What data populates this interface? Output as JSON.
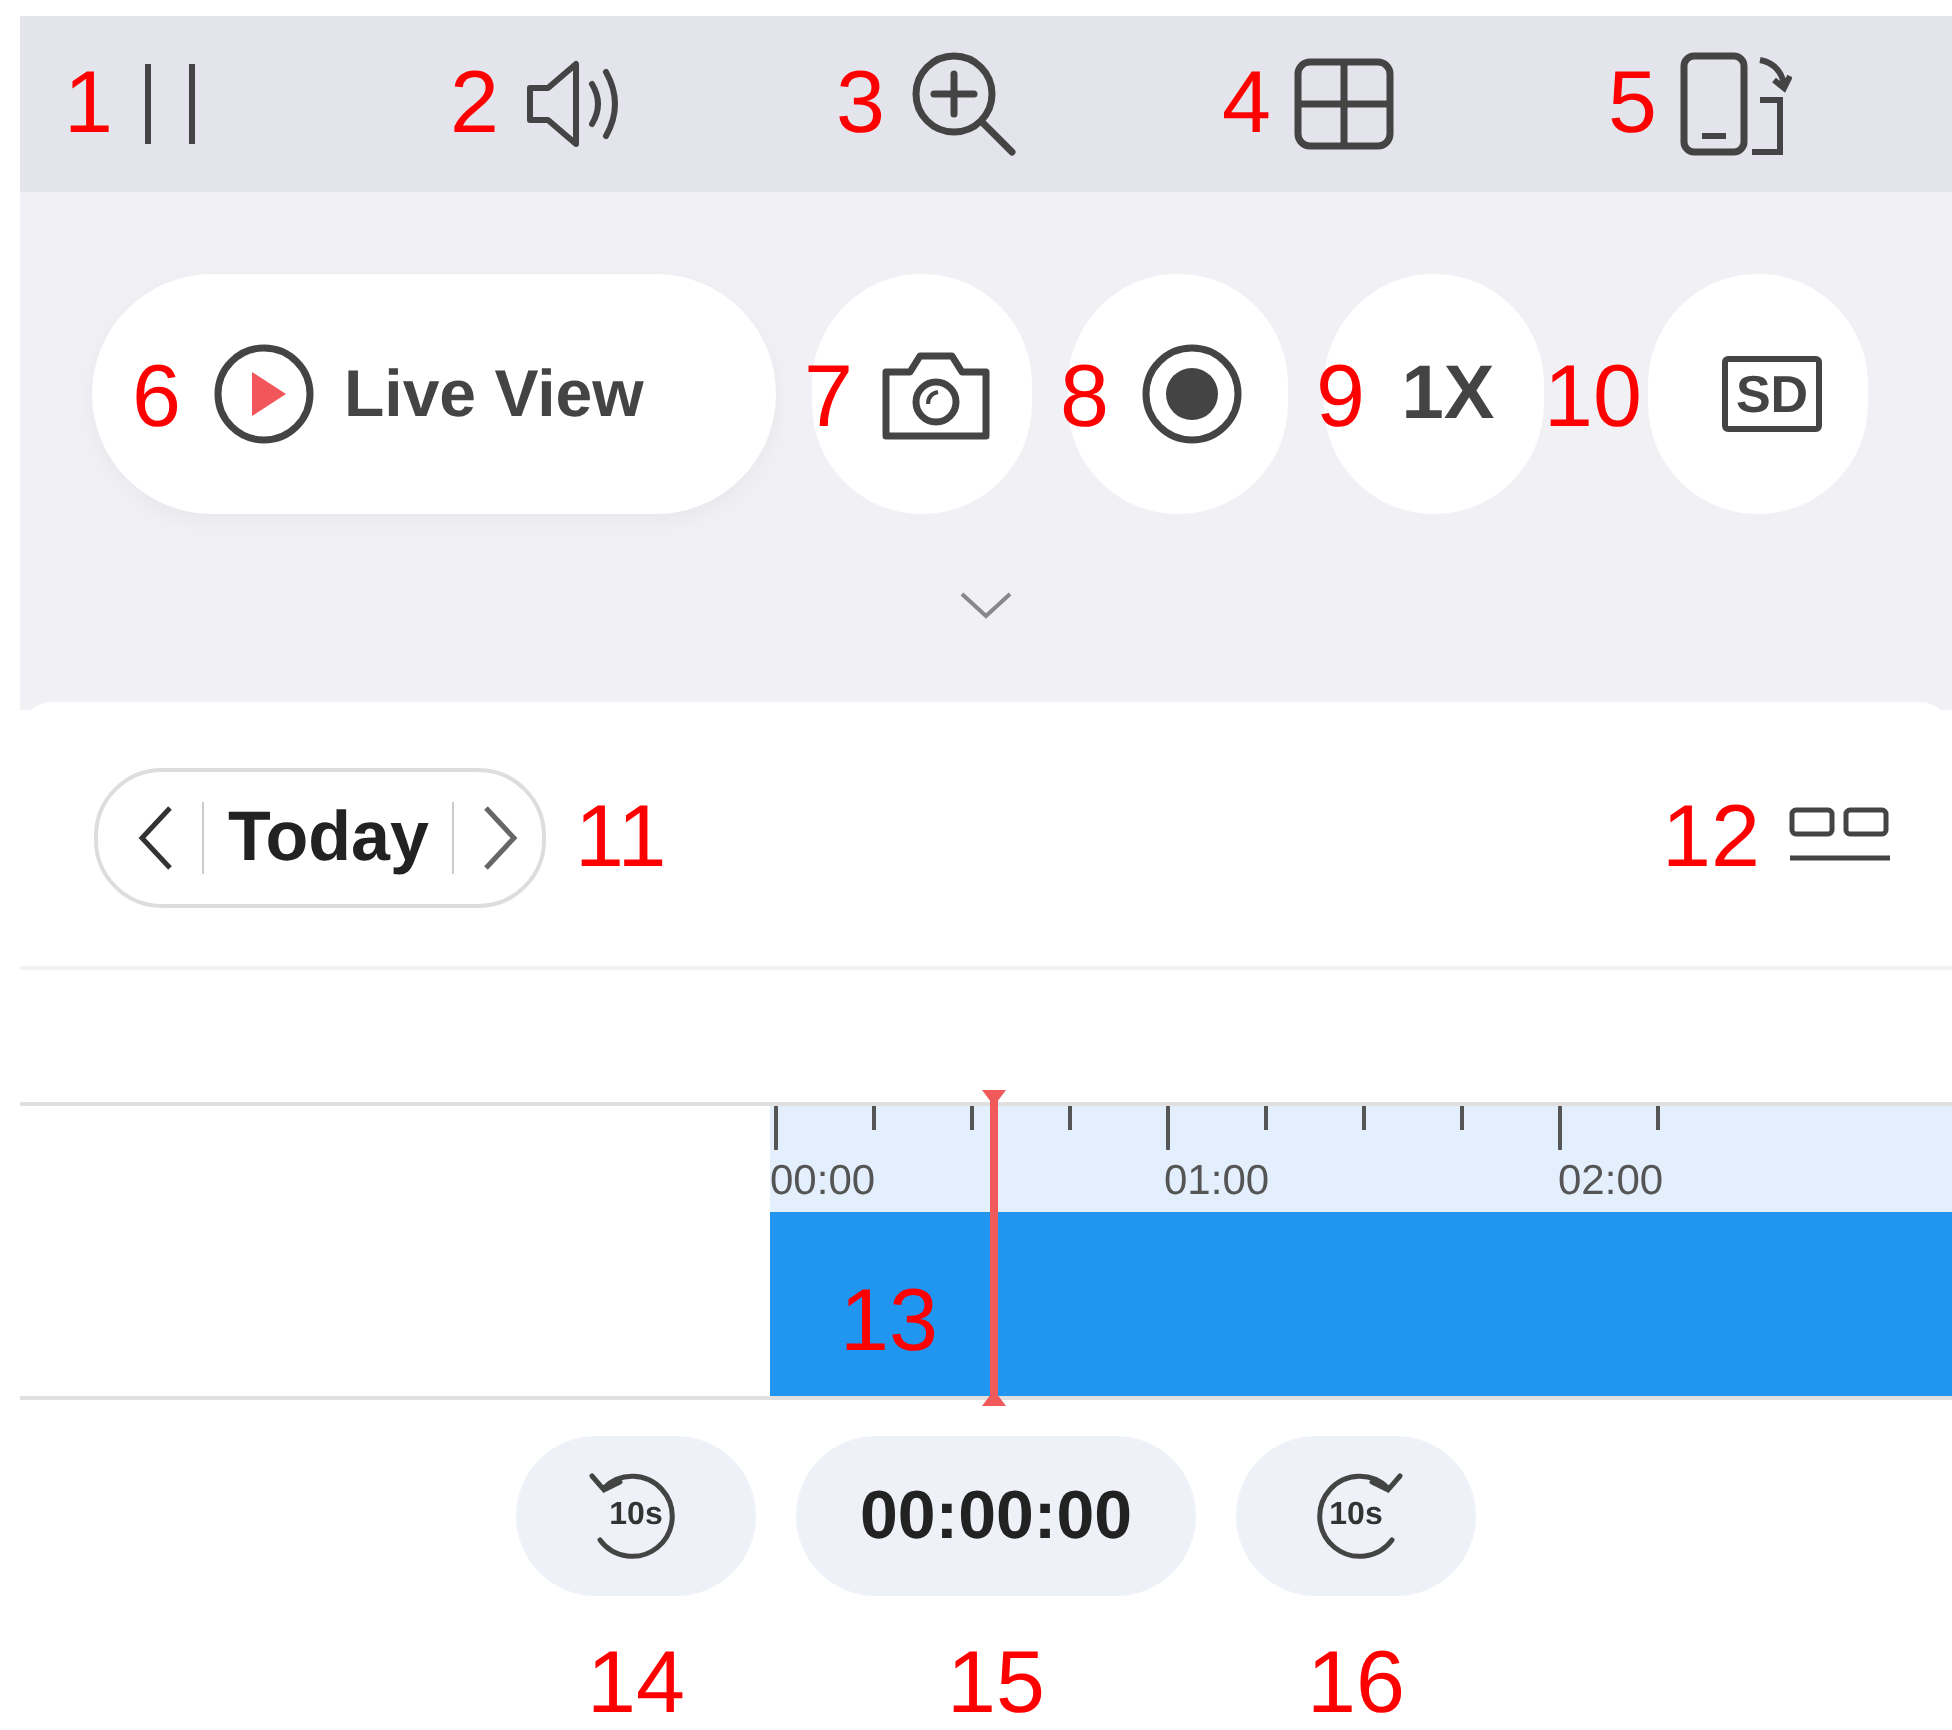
{
  "toolbar": [
    {
      "callout": "1",
      "kind": "pause"
    },
    {
      "callout": "2",
      "kind": "sound"
    },
    {
      "callout": "3",
      "kind": "zoom"
    },
    {
      "callout": "4",
      "kind": "grid"
    },
    {
      "callout": "5",
      "kind": "rotate"
    }
  ],
  "controls": [
    {
      "callout": "6",
      "kind": "live",
      "label": "Live View"
    },
    {
      "callout": "7",
      "kind": "snapshot"
    },
    {
      "callout": "8",
      "kind": "record"
    },
    {
      "callout": "9",
      "kind": "speed",
      "label": "1X"
    },
    {
      "callout": "10",
      "kind": "quality",
      "label": "SD"
    }
  ],
  "date_nav": {
    "callout": "11",
    "label": "Today"
  },
  "layout_toggle": {
    "callout": "12"
  },
  "timeline": {
    "callout": "13",
    "tick_labels": [
      "00:00",
      "01:00",
      "02:00"
    ]
  },
  "playback": [
    {
      "callout": "14",
      "kind": "rewind",
      "label": "10s"
    },
    {
      "callout": "15",
      "kind": "time",
      "label": "00:00:00"
    },
    {
      "callout": "16",
      "kind": "forward",
      "label": "10s"
    }
  ]
}
